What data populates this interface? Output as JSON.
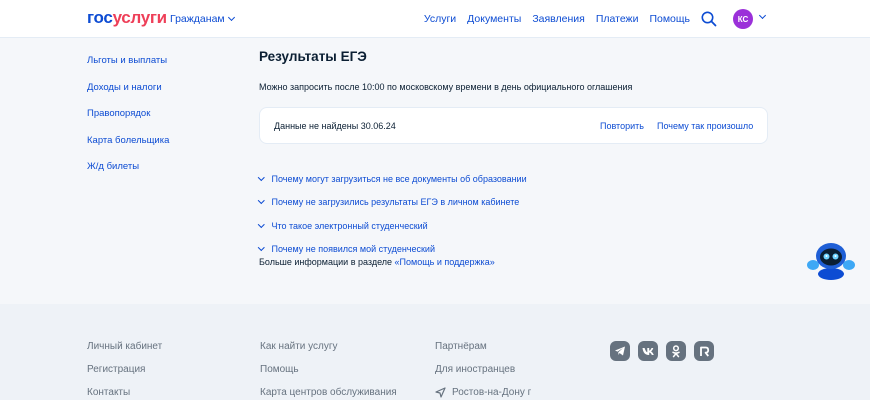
{
  "header": {
    "logo_part1": "гос",
    "logo_part2": "услуги",
    "audience": "Гражданам",
    "nav": [
      "Услуги",
      "Документы",
      "Заявления",
      "Платежи",
      "Помощь"
    ],
    "avatar_initials": "КС"
  },
  "sidebar": {
    "items": [
      "Льготы и выплаты",
      "Доходы и налоги",
      "Правопорядок",
      "Карта болельщика",
      "Ж/д билеты"
    ]
  },
  "main": {
    "title": "Результаты ЕГЭ",
    "hint": "Можно запросить после 10:00 по московскому времени в день официального оглашения",
    "card": {
      "message": "Данные не найдены 30.06.24",
      "retry": "Повторить",
      "why": "Почему так произошло"
    },
    "faq": [
      "Почему могут загрузиться не все документы об образовании",
      "Почему не загрузились результаты ЕГЭ в личном кабинете",
      "Что такое электронный студенческий",
      "Почему не появился мой студенческий"
    ],
    "more_info_text": "Больше информации в разделе ",
    "more_info_link": "«Помощь и поддержка»"
  },
  "footer": {
    "col1": [
      "Личный кабинет",
      "Регистрация",
      "Контакты"
    ],
    "col2": [
      "Как найти услугу",
      "Помощь",
      "Карта центров обслуживания"
    ],
    "col3": [
      "Партнёрам",
      "Для иностранцев"
    ],
    "location": "Ростов-на-Дону г",
    "socials": [
      "telegram-icon",
      "vk-icon",
      "odnoklassniki-icon",
      "rutube-icon"
    ]
  },
  "colors": {
    "accent": "#0d4cd3",
    "logo_red": "#ee3f58",
    "avatar": "#9b30d9",
    "footer_text": "#66727f"
  }
}
